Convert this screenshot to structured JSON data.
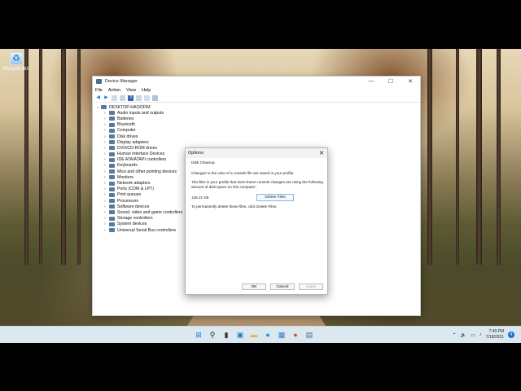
{
  "desktop": {
    "recycle_bin_label": "Recycle Bin"
  },
  "device_manager": {
    "title": "Device Manager",
    "menu": [
      "File",
      "Action",
      "View",
      "Help"
    ],
    "window_buttons": [
      "—",
      "☐",
      "✕"
    ],
    "tree_root": "DESKTOP-HAOOFIM",
    "tree_items": [
      "Audio inputs and outputs",
      "Batteries",
      "Bluetooth",
      "Computer",
      "Disk drives",
      "Display adapters",
      "DVD/CD-ROM drives",
      "Human Interface Devices",
      "IDE ATA/ATAPI controllers",
      "Keyboards",
      "Mice and other pointing devices",
      "Monitors",
      "Network adapters",
      "Ports (COM & LPT)",
      "Print queues",
      "Processors",
      "Software devices",
      "Sound, video and game controllers",
      "Storage controllers",
      "System devices",
      "Universal Serial Bus controllers"
    ]
  },
  "options_dialog": {
    "title": "Options",
    "group_label": "Disk Cleanup",
    "text1": "Changes to the view of a console file are saved in your profile.",
    "text2": "The files in your profile that store these console changes are using the following amount of disk space on this computer:",
    "size": "136.21 KB",
    "delete_button": "Delete Files",
    "text3": "To permanently delete these files, click Delete Files.",
    "ok": "OK",
    "cancel": "Cancel",
    "apply": "Apply"
  },
  "taskbar": {
    "apps": [
      {
        "name": "start-icon",
        "glyph": "⊞",
        "color": "#1d6fd1"
      },
      {
        "name": "search-icon",
        "glyph": "⚲",
        "color": "#222222"
      },
      {
        "name": "task-view-icon",
        "glyph": "▮",
        "color": "#333333"
      },
      {
        "name": "widgets-icon",
        "glyph": "▣",
        "color": "#1b7fbf"
      },
      {
        "name": "file-explorer-icon",
        "glyph": "▬",
        "color": "#e8b33a"
      },
      {
        "name": "edge-icon",
        "glyph": "●",
        "color": "#1a9bd7"
      },
      {
        "name": "store-icon",
        "glyph": "▦",
        "color": "#2a7ed3"
      },
      {
        "name": "chrome-icon",
        "glyph": "●",
        "color": "#d84a38"
      },
      {
        "name": "device-manager-icon",
        "glyph": "▤",
        "color": "#4a6e8f"
      }
    ],
    "time": "7:49 PM",
    "date": "7/18/2021",
    "notification_count": "4"
  }
}
